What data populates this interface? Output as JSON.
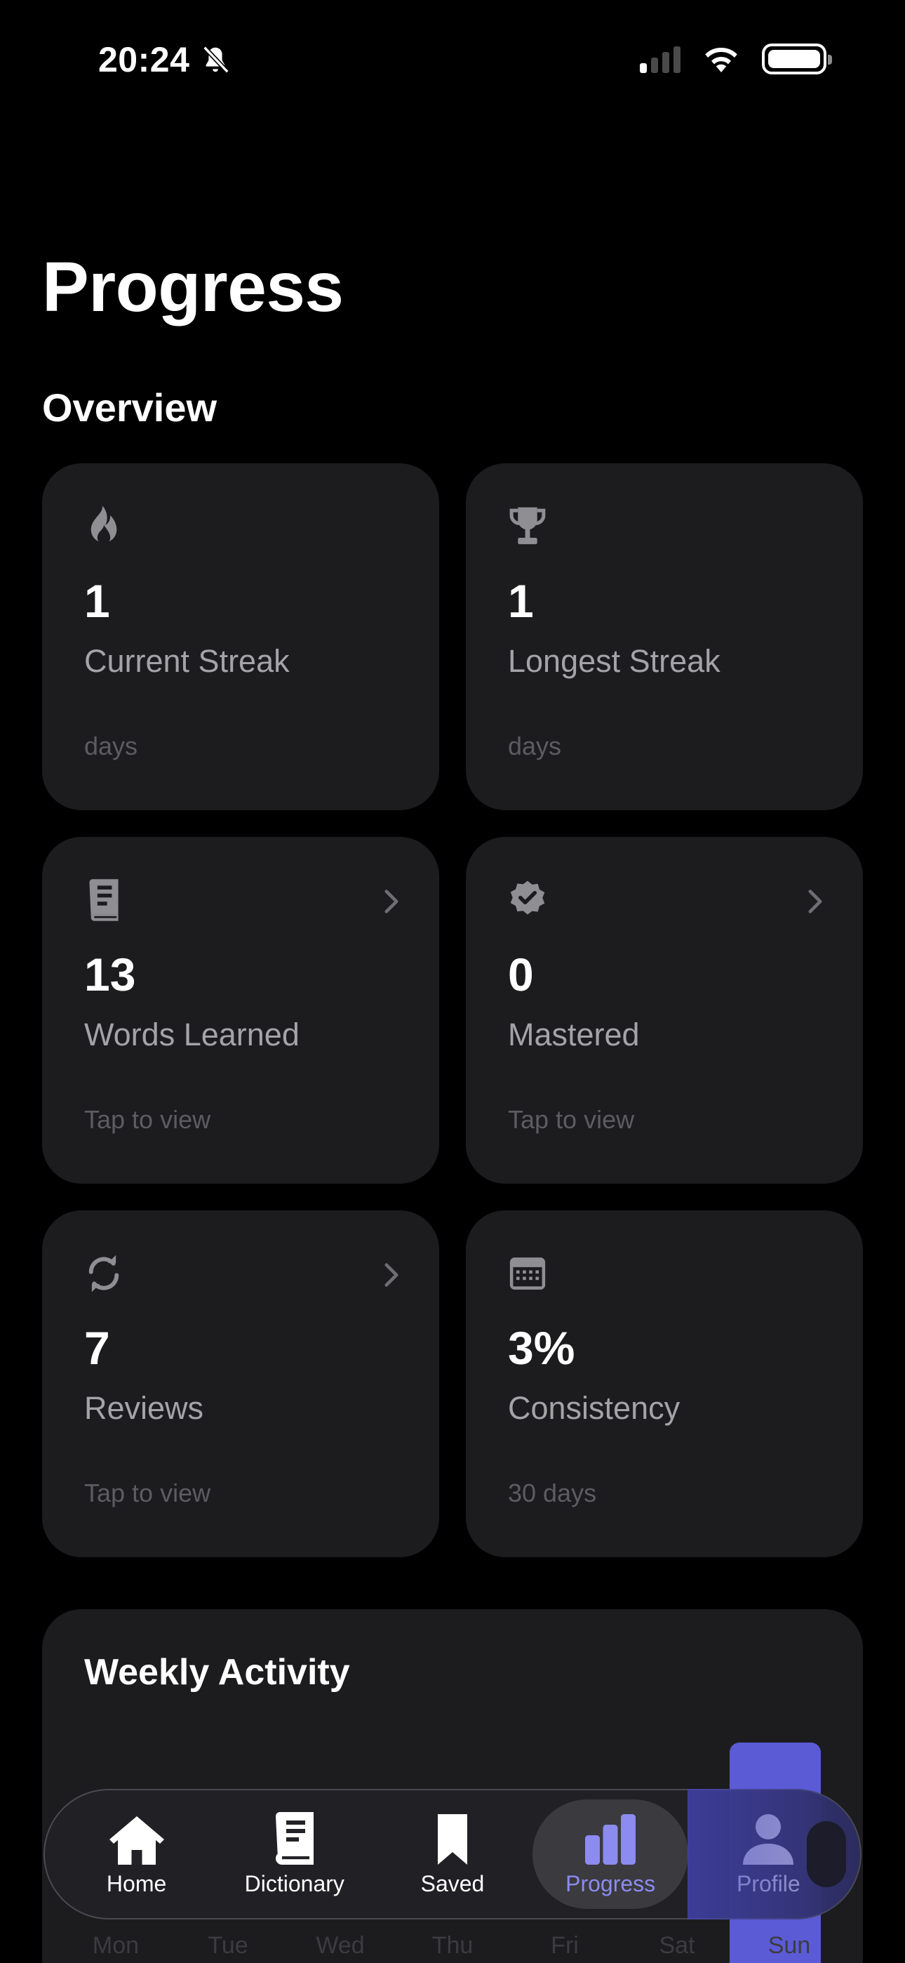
{
  "status_bar": {
    "time": "20:24"
  },
  "page": {
    "title": "Progress",
    "section": "Overview"
  },
  "cards": [
    {
      "icon": "flame-icon",
      "value": "1",
      "label": "Current Streak",
      "sub": "days",
      "chevron": false
    },
    {
      "icon": "trophy-icon",
      "value": "1",
      "label": "Longest Streak",
      "sub": "days",
      "chevron": false
    },
    {
      "icon": "book-icon",
      "value": "13",
      "label": "Words Learned",
      "sub": "Tap to view",
      "chevron": true
    },
    {
      "icon": "checkmark-seal-icon",
      "value": "0",
      "label": "Mastered",
      "sub": "Tap to view",
      "chevron": true
    },
    {
      "icon": "refresh-icon",
      "value": "7",
      "label": "Reviews",
      "sub": "Tap to view",
      "chevron": true
    },
    {
      "icon": "calendar-icon",
      "value": "3%",
      "label": "Consistency",
      "sub": "30 days",
      "chevron": false
    }
  ],
  "weekly": {
    "title": "Weekly Activity",
    "days": [
      "Mon",
      "Tue",
      "Wed",
      "Thu",
      "Fri",
      "Sat",
      "Sun"
    ]
  },
  "tabs": [
    {
      "label": "Home",
      "icon": "home-icon",
      "active": false
    },
    {
      "label": "Dictionary",
      "icon": "book-icon",
      "active": false
    },
    {
      "label": "Saved",
      "icon": "bookmark-icon",
      "active": false
    },
    {
      "label": "Progress",
      "icon": "chart-bar-icon",
      "active": true
    },
    {
      "label": "Profile",
      "icon": "person-icon",
      "active": false
    }
  ],
  "colors": {
    "accent": "#8b8bf0",
    "card": "#1c1c1e",
    "bar": "#5b5bd6"
  }
}
